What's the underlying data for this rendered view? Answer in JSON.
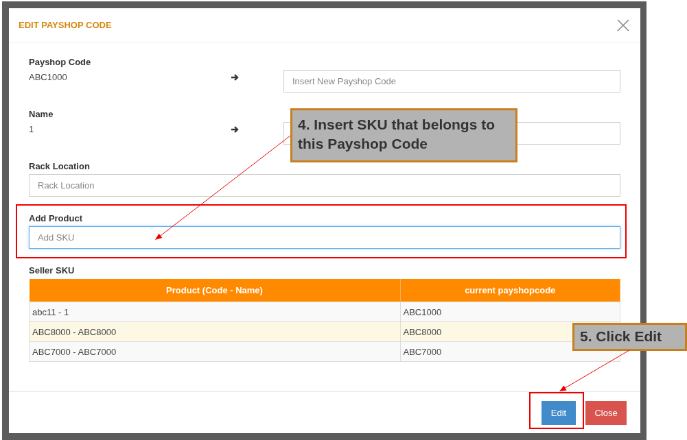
{
  "dialog": {
    "title": "EDIT PAYSHOP CODE",
    "fields": [
      {
        "kind": "transfer",
        "label": "Payshop Code",
        "current": "ABC1000",
        "placeholder": "Insert New Payshop Code"
      },
      {
        "kind": "transfer",
        "label": "Name",
        "current": "1"
      },
      {
        "kind": "input",
        "label": "Rack Location",
        "placeholder": "Rack Location",
        "focused": false
      },
      {
        "kind": "input",
        "label": "Add Product",
        "placeholder": "Add SKU",
        "focused": true,
        "highlighted": true
      }
    ],
    "table": {
      "title": "Seller SKU",
      "columns": [
        "Product (Code - Name)",
        "current payshopcode"
      ],
      "rows": [
        {
          "cells": [
            "abc11 - 1",
            "ABC1000"
          ],
          "hovered": false
        },
        {
          "cells": [
            "ABC8000 - ABC8000",
            "ABC8000"
          ],
          "hovered": true
        },
        {
          "cells": [
            "ABC7000 - ABC7000",
            "ABC7000"
          ],
          "hovered": false
        }
      ]
    },
    "buttons": [
      {
        "label": "Edit",
        "kind": "primary",
        "highlighted": true
      },
      {
        "label": "Close",
        "kind": "danger"
      }
    ]
  },
  "annotations": [
    {
      "text": "4. Insert SKU that belongs to this Payshop Code"
    },
    {
      "text": "5. Click Edit"
    }
  ]
}
